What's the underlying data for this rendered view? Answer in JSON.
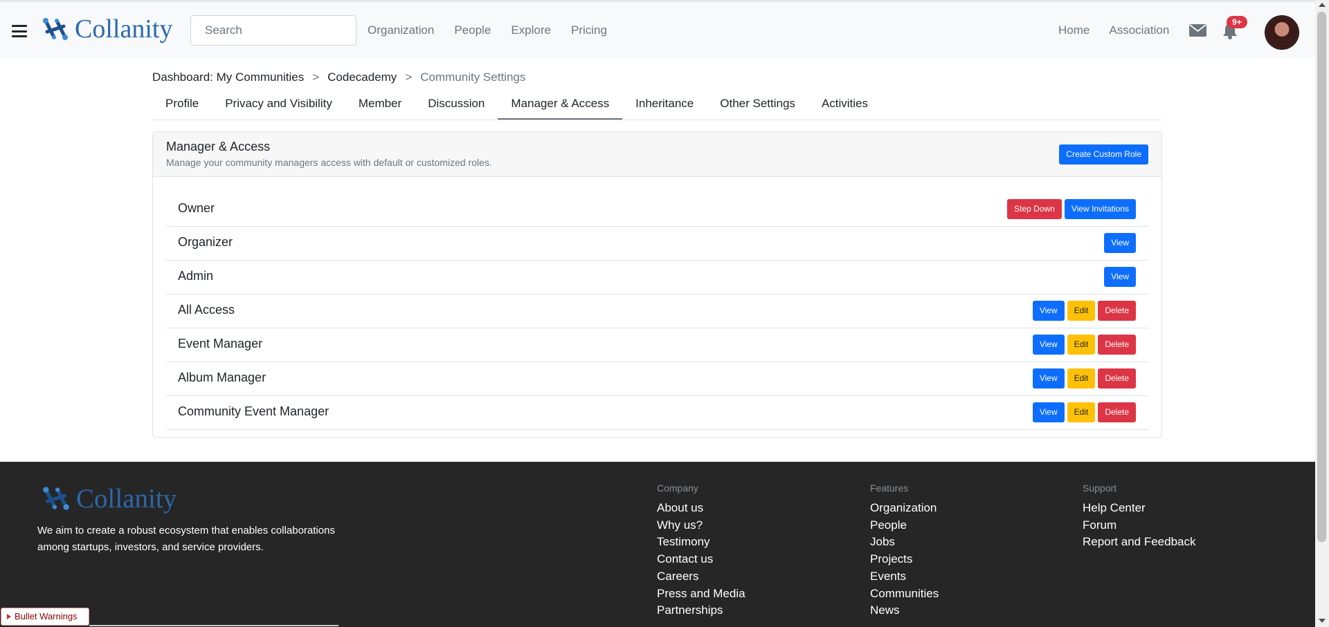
{
  "header": {
    "brand": "Collanity",
    "search_placeholder": "Search",
    "nav_left": [
      "Organization",
      "People",
      "Explore",
      "Pricing"
    ],
    "nav_right": [
      "Home",
      "Association"
    ],
    "notification_count": "9+"
  },
  "breadcrumb": {
    "items": [
      "Dashboard: My Communities",
      "Codecademy"
    ],
    "current": "Community Settings",
    "separator": ">"
  },
  "tabs": [
    "Profile",
    "Privacy and Visibility",
    "Member",
    "Discussion",
    "Manager & Access",
    "Inheritance",
    "Other Settings",
    "Activities"
  ],
  "active_tab": "Manager & Access",
  "card": {
    "title": "Manager & Access",
    "subtitle": "Manage your community managers access with default or customized roles.",
    "create_button": "Create Custom Role"
  },
  "roles": [
    {
      "name": "Owner",
      "actions": [
        {
          "label": "Step Down",
          "style": "danger"
        },
        {
          "label": "View Invitations",
          "style": "primary"
        }
      ]
    },
    {
      "name": "Organizer",
      "actions": [
        {
          "label": "View",
          "style": "primary"
        }
      ]
    },
    {
      "name": "Admin",
      "actions": [
        {
          "label": "View",
          "style": "primary"
        }
      ]
    },
    {
      "name": "All Access",
      "actions": [
        {
          "label": "View",
          "style": "primary"
        },
        {
          "label": "Edit",
          "style": "warning"
        },
        {
          "label": "Delete",
          "style": "danger"
        }
      ]
    },
    {
      "name": "Event Manager",
      "actions": [
        {
          "label": "View",
          "style": "primary"
        },
        {
          "label": "Edit",
          "style": "warning"
        },
        {
          "label": "Delete",
          "style": "danger"
        }
      ]
    },
    {
      "name": "Album Manager",
      "actions": [
        {
          "label": "View",
          "style": "primary"
        },
        {
          "label": "Edit",
          "style": "warning"
        },
        {
          "label": "Delete",
          "style": "danger"
        }
      ]
    },
    {
      "name": "Community Event Manager",
      "actions": [
        {
          "label": "View",
          "style": "primary"
        },
        {
          "label": "Edit",
          "style": "warning"
        },
        {
          "label": "Delete",
          "style": "danger"
        }
      ]
    }
  ],
  "footer": {
    "brand": "Collanity",
    "tagline": "We aim to create a robust ecosystem that enables collaborations among startups, investors, and service providers.",
    "columns": [
      {
        "title": "Company",
        "links": [
          "About us",
          "Why us?",
          "Testimony",
          "Contact us",
          "Careers",
          "Press and Media",
          "Partnerships"
        ]
      },
      {
        "title": "Features",
        "links": [
          "Organization",
          "People",
          "Jobs",
          "Projects",
          "Events",
          "Communities",
          "News"
        ]
      },
      {
        "title": "Support",
        "links": [
          "Help Center",
          "Forum",
          "Report and Feedback"
        ]
      }
    ]
  },
  "debug": {
    "bullet_warnings": "Bullet Warnings"
  },
  "colors": {
    "brand": "#2a69ac",
    "primary": "#0d6efd",
    "danger": "#dc3545",
    "warning": "#ffc107",
    "footer_bg": "#262626"
  }
}
